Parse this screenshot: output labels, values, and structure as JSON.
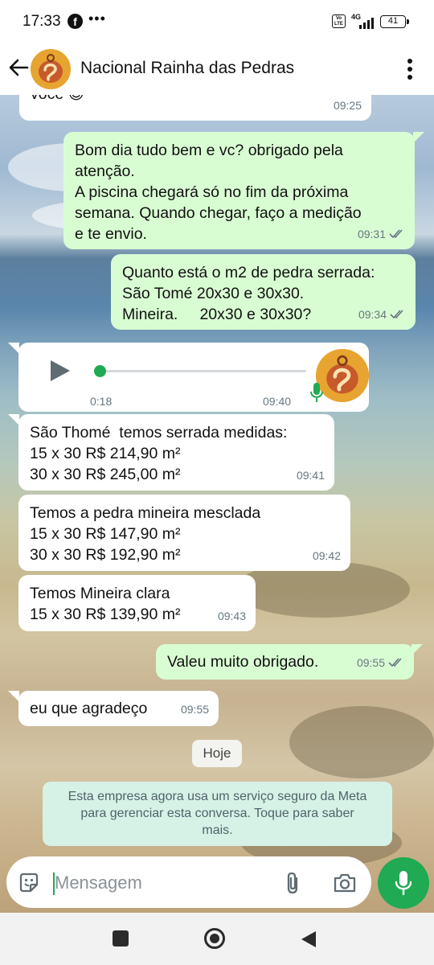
{
  "status_bar": {
    "time": "17:33",
    "network": "4G",
    "volte": "Vo LTE",
    "battery": "41"
  },
  "header": {
    "contact_name": "Nacional Rainha das Pedras"
  },
  "messages": [
    {
      "dir": "in",
      "text": "você 😊",
      "time": "09:25"
    },
    {
      "dir": "out",
      "text": "Bom dia tudo bem e vc? obrigado pela\natenção.\nA piscina chegará só no fim da próxima\nsemana. Quando chegar, faço a medição\ne te envio.",
      "time": "09:31"
    },
    {
      "dir": "out",
      "text": "Quanto está o m2 de pedra serrada:\nSão Tomé 20x30 e 30x30.\nMineira.     20x30 e 30x30?",
      "time": "09:34"
    },
    {
      "dir": "in",
      "type": "audio",
      "duration": "0:18",
      "time": "09:40"
    },
    {
      "dir": "in",
      "text": "São Thomé  temos serrada medidas:\n15 x 30 R$ 214,90 m²\n30 x 30 R$ 245,00 m²",
      "time": "09:41"
    },
    {
      "dir": "in",
      "text": "Temos a pedra mineira mesclada\n15 x 30 R$ 147,90 m²\n30 x 30 R$ 192,90 m²",
      "time": "09:42"
    },
    {
      "dir": "in",
      "text": "Temos Mineira clara\n15 x 30 R$ 139,90 m²",
      "time": "09:43"
    },
    {
      "dir": "out",
      "text": "Valeu muito obrigado.",
      "time": "09:55"
    },
    {
      "dir": "in",
      "text": "eu que agradeço",
      "time": "09:55"
    }
  ],
  "date_chip": "Hoje",
  "system_notice": "Esta empresa agora usa um serviço seguro da Meta\npara gerenciar esta conversa. Toque para saber\nmais.",
  "composer": {
    "placeholder": "Mensagem"
  },
  "colors": {
    "accent_green": "#1faa53",
    "outgoing_bubble": "#d9fdd3",
    "incoming_bubble": "#ffffff",
    "read_ticks": "#667781"
  }
}
